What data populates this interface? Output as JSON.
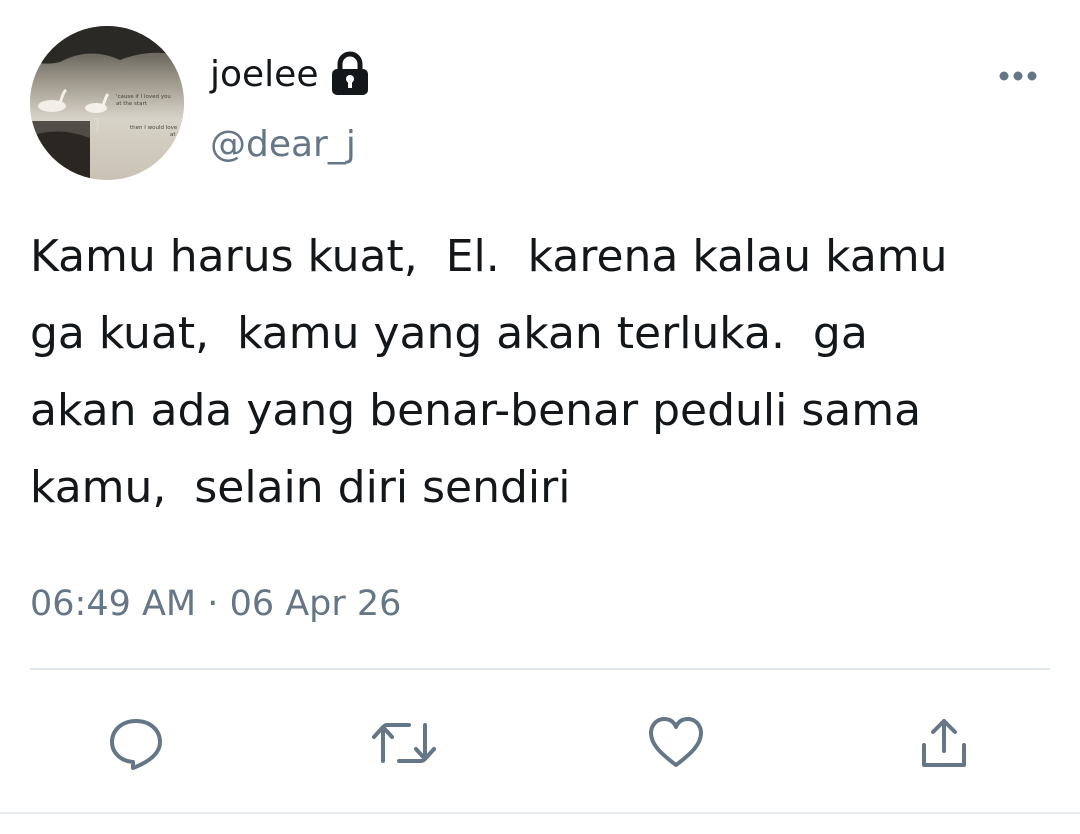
{
  "tweet": {
    "display_name": "joelee",
    "handle": "@dear_j",
    "protected_icon": "lock-icon",
    "avatar_caption_1": "'cause if I loved you",
    "avatar_caption_2": "at the start",
    "avatar_caption_3": "then I would love",
    "avatar_caption_4": "at th",
    "text": "Kamu harus kuat,  El.  karena kalau kamu\nga kuat,  kamu yang akan terluka.  ga\nakan ada yang benar-benar peduli sama\nkamu,  selain diri sendiri",
    "time": "06:49 AM",
    "separator": "·",
    "date": "06 Apr 26"
  },
  "actions": [
    {
      "name": "reply",
      "icon": "comment-icon"
    },
    {
      "name": "retweet",
      "icon": "retweet-icon"
    },
    {
      "name": "like",
      "icon": "heart-icon"
    },
    {
      "name": "share",
      "icon": "share-icon"
    }
  ],
  "colors": {
    "text_primary": "#14171a",
    "text_secondary": "#657786",
    "icon": "#657786",
    "divider": "#e1e8ed"
  }
}
